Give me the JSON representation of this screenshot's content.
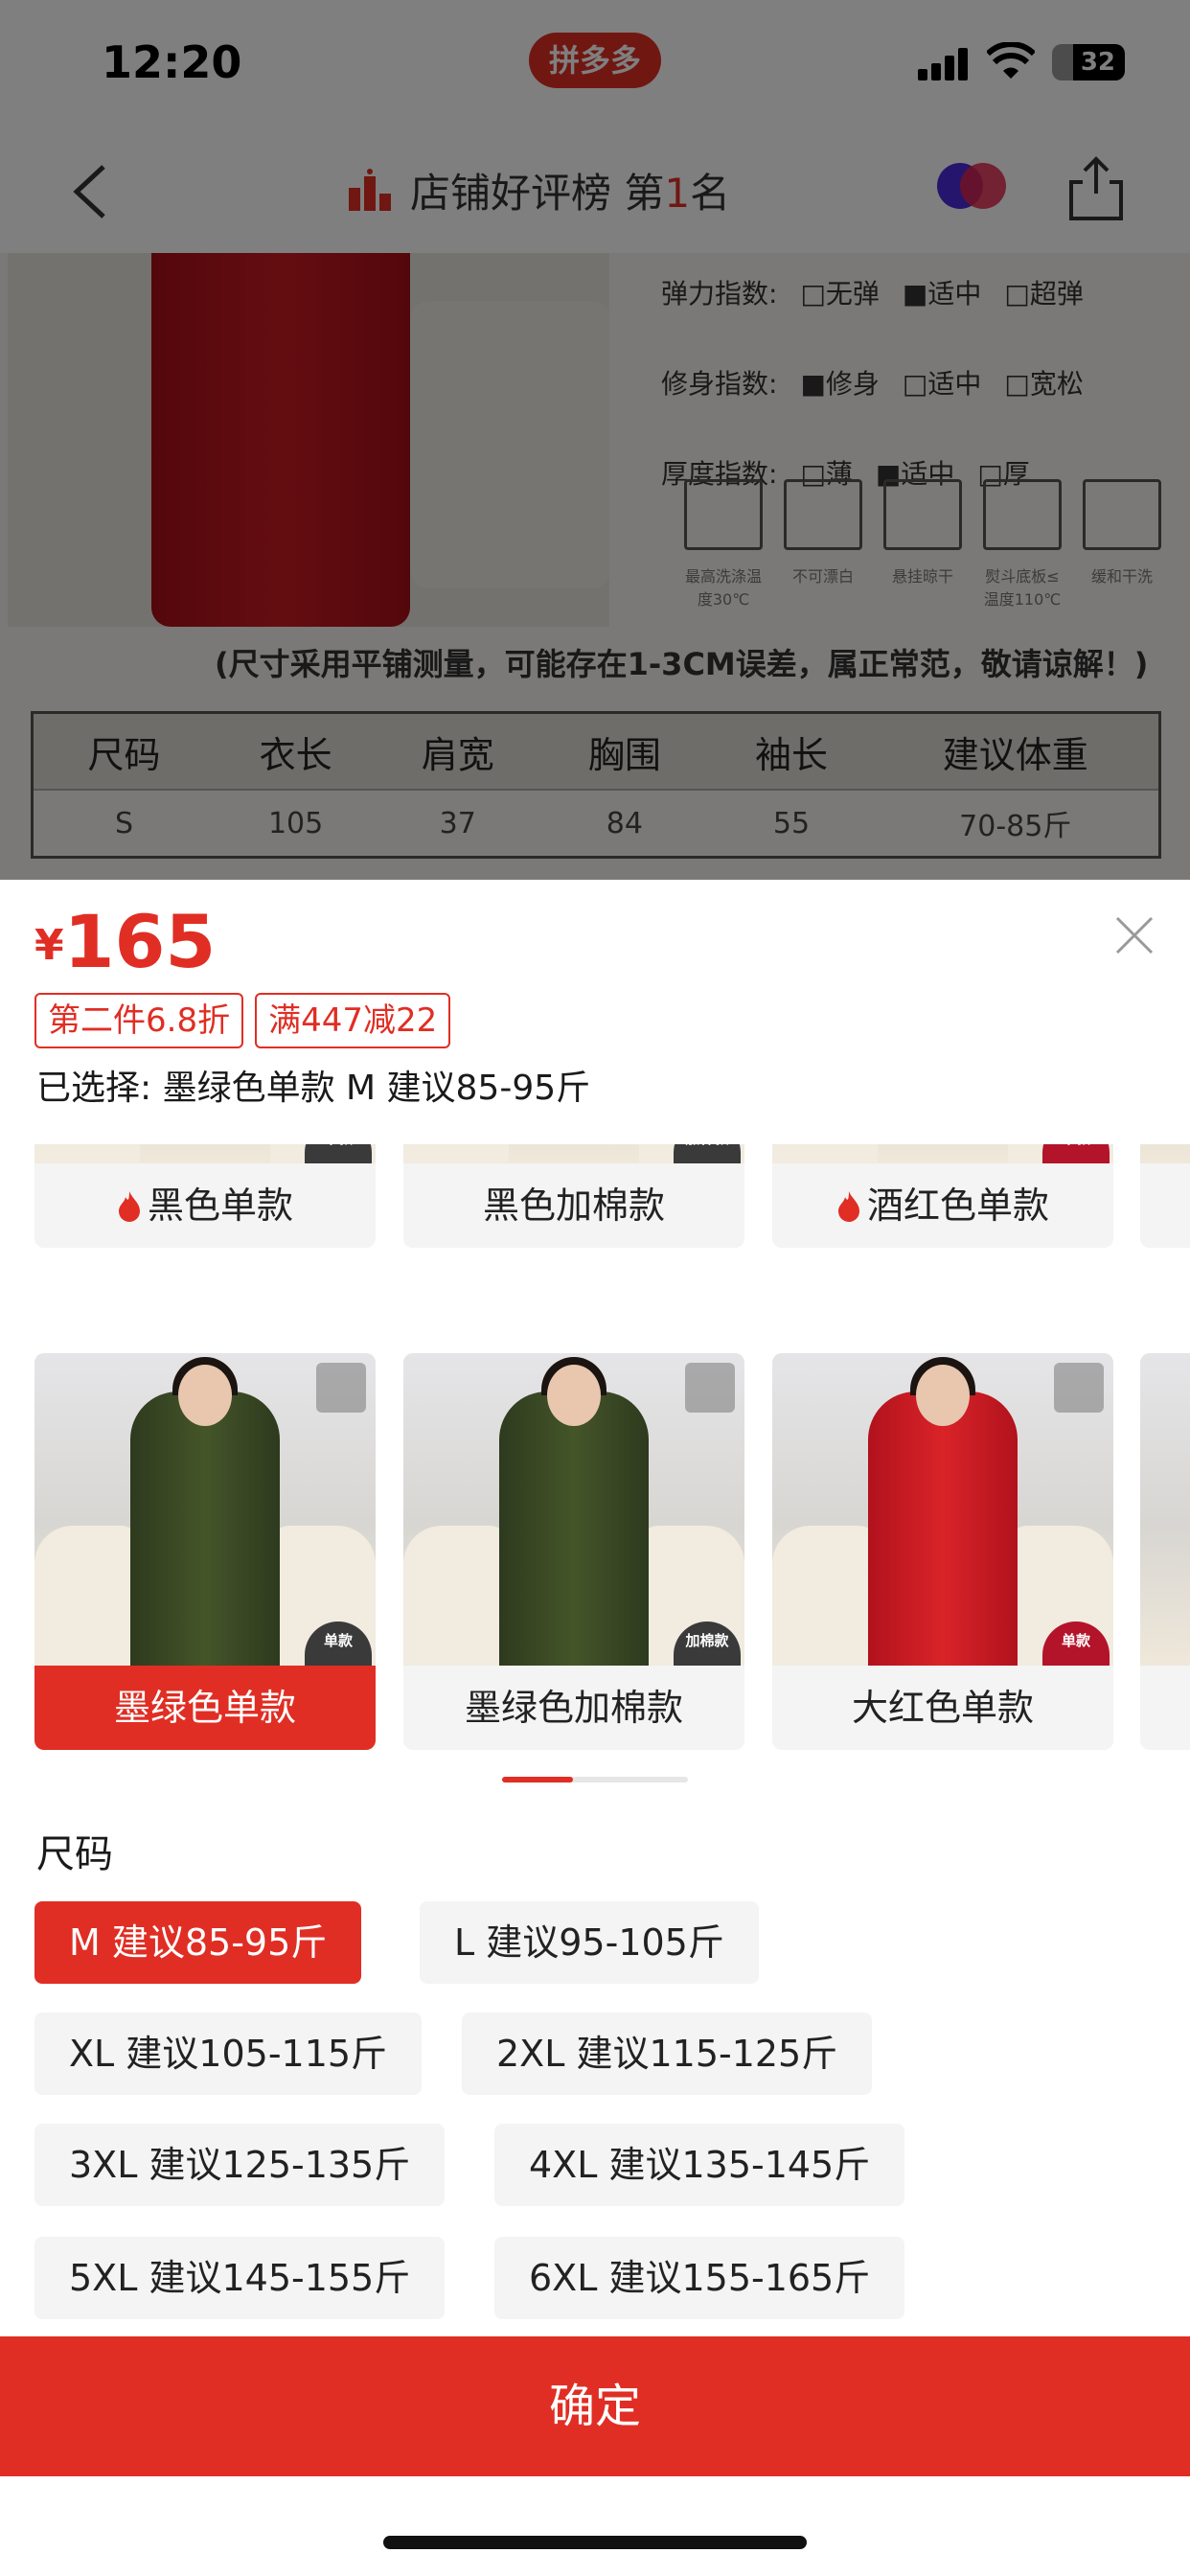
{
  "status_bar": {
    "time": "12:20",
    "app_badge": "拼多多",
    "battery": "32"
  },
  "nav": {
    "rank_prefix": "店铺好评榜 第",
    "rank_number": "1",
    "rank_suffix": "名"
  },
  "background_detail": {
    "spec_rows": [
      {
        "label": "弹力指数:",
        "options": [
          "□无弹",
          "■适中",
          "□超弹"
        ]
      },
      {
        "label": "修身指数:",
        "options": [
          "■修身",
          "□适中",
          "□宽松"
        ]
      },
      {
        "label": "厚度指数:",
        "options": [
          "□薄",
          "■适中",
          "□厚"
        ]
      }
    ],
    "care_labels": [
      "最高洗涤温度30℃",
      "不可漂白",
      "悬挂晾干",
      "熨斗底板≤温度110℃",
      "缓和干洗"
    ],
    "measure_note": "(尺寸采用平铺测量，可能存在1-3CM误差，属正常范，敬请谅解！)",
    "table_headers": [
      "尺码",
      "衣长",
      "肩宽",
      "胸围",
      "袖长",
      "建议体重"
    ],
    "table_rows": [
      [
        "S",
        "105",
        "37",
        "84",
        "55",
        "70-85斤"
      ]
    ]
  },
  "sheet": {
    "price_currency": "¥",
    "price_value": "165",
    "promos": [
      "第二件6.8折",
      "满447减22"
    ],
    "selected_text": "已选择: 墨绿色单款 M 建议85-95斤",
    "variants_top": [
      {
        "label": "黑色单款",
        "badge": "单款",
        "hot": true
      },
      {
        "label": "黑色加棉款",
        "badge": "加棉款",
        "hot": false
      },
      {
        "label": "酒红色单款",
        "badge": "单款",
        "hot": true
      }
    ],
    "variants_bottom": [
      {
        "label": "墨绿色单款",
        "badge": "单款",
        "active": true
      },
      {
        "label": "墨绿色加棉款",
        "badge": "加棉款",
        "active": false
      },
      {
        "label": "大红色单款",
        "badge": "单款",
        "active": false
      }
    ],
    "scroll_progress": 0.38,
    "size_title": "尺码",
    "sizes": [
      {
        "label": "M 建议85-95斤",
        "active": true
      },
      {
        "label": "L 建议95-105斤",
        "active": false
      },
      {
        "label": "XL 建议105-115斤",
        "active": false
      },
      {
        "label": "2XL 建议115-125斤",
        "active": false
      },
      {
        "label": "3XL 建议125-135斤",
        "active": false
      },
      {
        "label": "4XL 建议135-145斤",
        "active": false
      },
      {
        "label": "5XL 建议145-155斤",
        "active": false
      },
      {
        "label": "6XL 建议155-165斤",
        "active": false
      }
    ],
    "confirm_label": "确定"
  },
  "colors": {
    "accent": "#e02e24"
  }
}
